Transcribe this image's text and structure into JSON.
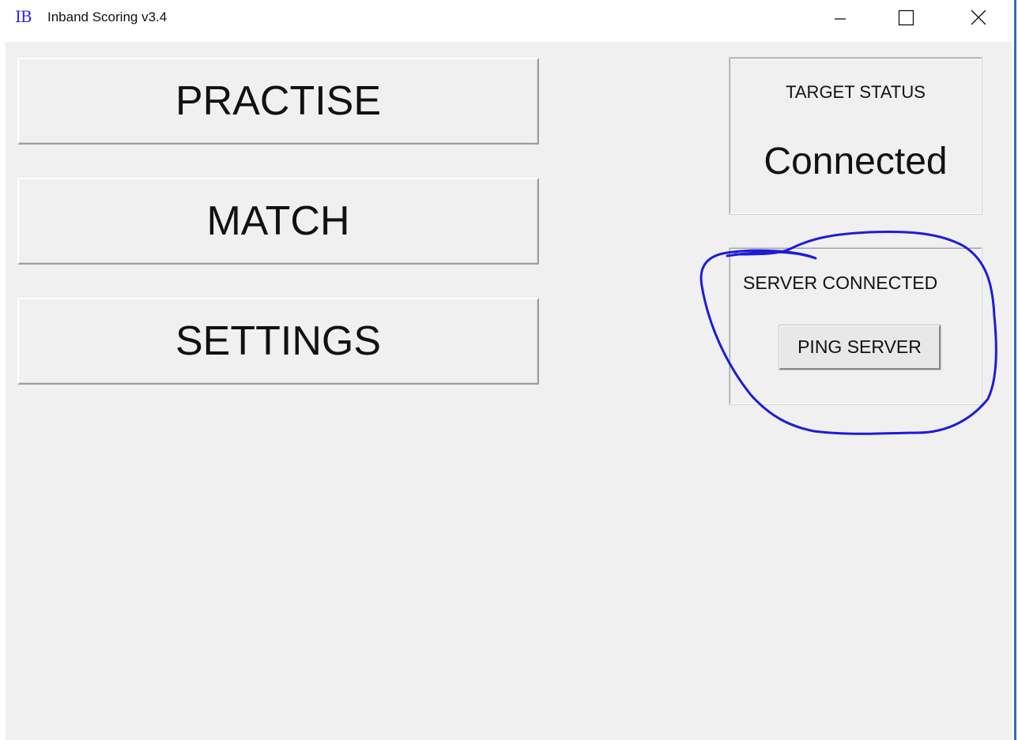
{
  "window": {
    "title": "Inband Scoring v3.4",
    "icon_text": "IB",
    "icon_color": "#2b2bdc",
    "controls": {
      "minimize": "minimize-icon",
      "maximize": "maximize-icon",
      "close": "close-icon"
    }
  },
  "main_buttons": {
    "practise": "PRACTISE",
    "match": "MATCH",
    "settings": "SETTINGS"
  },
  "target_status": {
    "label": "TARGET STATUS",
    "value": "Connected"
  },
  "server_status": {
    "label": "SERVER CONNECTED",
    "ping_button": "PING SERVER"
  },
  "annotation": {
    "color": "#1c1cd8",
    "shape": "hand-drawn circle around server status box"
  }
}
